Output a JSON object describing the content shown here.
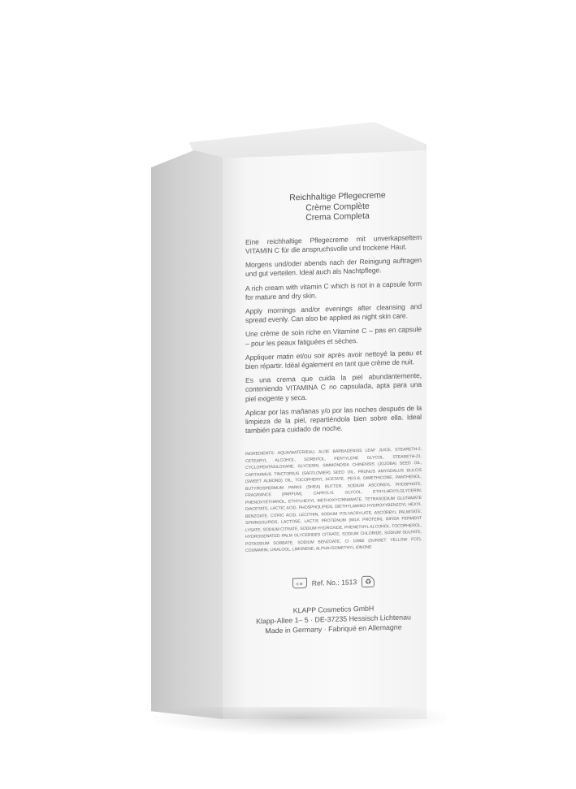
{
  "product": {
    "titles": [
      "Reichhaltige Pflegecreme",
      "Crème Complète",
      "Crema Completa"
    ],
    "paragraphs": [
      "Eine reichhaltige Pflegecreme mit unverkapseltem VITAMIN C für die anspruchsvolle und trockene Haut.",
      "Morgens und/oder abends nach der Reinigung auftragen und gut verteilen. Ideal auch als Nachtpflege.",
      "A rich cream with vitamin C which is not in a capsule form for mature and dry skin.",
      "Apply mornings and/or evenings after cleansing and spread evenly. Can also be applied as night skin care.",
      "Une crème de soin riche en Vitamine C – pas en capsule – pour les peaux fatiguées et sèches.",
      "Appliquer matin et/ou soir après avoir nettoyé la peau et bien répartir. Idéal également en tant que crème de nuit.",
      "Es una crema que cuida la piel abundantemente, conteniendo VITAMINA C no capsulada, apta para una piel exigente y seca.",
      "Aplicar por las mañanas y/o por las noches después de la limpieza de la piel, repartiéndola bien sobre ella. Ideal también para cuidado de noche."
    ],
    "ingredients": "Ingredients: Aqua/Water/Eau, Aloe Barbadensis Leaf Juice, Steareth-2, Cetearyl Alcohol, Sorbitol, Pentylene Glycol, Steareth-21, Cyclopentasiloxane, Glycerin, Simmondsia Chinensis (Jojoba) Seed Oil, Carthamus Tinctorius (Safflower) Seed Oil, Prunus Amygdalus Dulcis (Sweet Almond) Oil, Tocopheryl Acetate, PEG-8, Dimethicone, Panthenol, Butyrospermum Parkii (Shea) Butter, Sodium Ascorbyl Phosphate, Fragrance (Parfum), Caprylyl Glycol, Ethylhexylglycerin, Phenoxyethanol, Ethylhexyl Methoxycinnamate, Tetrasodium Glutamate Diacetate, Lactic Acid, Phospholipids, Diethylamino Hydroxybenzoyl Hexyl Benzoate, Citric Acid, Lecithin, Sodium Polyacrylate, Ascorbyl Palmitate, Sphingolipids, Lactose, Lactis Proteinum (Milk Protein), Bifida Ferment Lysate, Sodium Citrate, Sodium Hydroxide, Phenethyl Alcohol, Tocopherol, Hydrogenated Palm Glycerides Citrate, Sodium Chloride, Sodium Sulfate, Potassium Sorbate, Sodium Benzoate, CI 15985 (Sunset Yellow FCF), Coumarin, Linalool, Limonene, Alpha-Isomethyl Ionone",
    "pao_label": "6 M",
    "ref": "Ref. No.: 1513",
    "recycle_symbol": "♻",
    "company_lines": [
      "KLAPP Cosmetics GmbH",
      "Klapp-Allee 1– 5 · DE-37235 Hessisch Lichtenau",
      "Made in Germany · Fabriqué en Allemagne"
    ]
  }
}
